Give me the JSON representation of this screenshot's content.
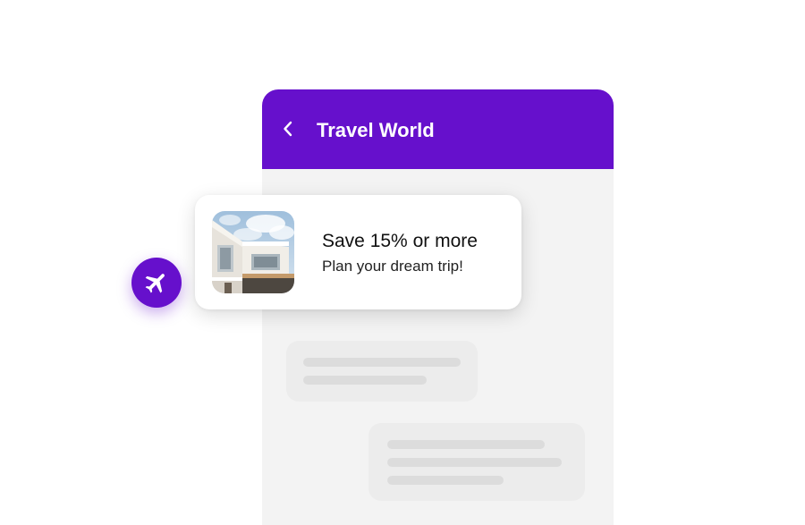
{
  "colors": {
    "brand": "#6610cc",
    "card_background": "#ffffff",
    "chat_background": "#f3f3f3",
    "bubble": "#ececec",
    "placeholder_line": "#dcdcdc"
  },
  "header": {
    "title": "Travel World",
    "back_icon": "chevron-left-icon"
  },
  "promo": {
    "title": "Save 15% or more",
    "subtitle": "Plan your dream trip!",
    "image": "hotel-building-photo"
  },
  "badge": {
    "icon": "airplane-icon"
  },
  "chat": {
    "bubbles": [
      {
        "lines": 2
      },
      {
        "lines": 3
      }
    ]
  }
}
